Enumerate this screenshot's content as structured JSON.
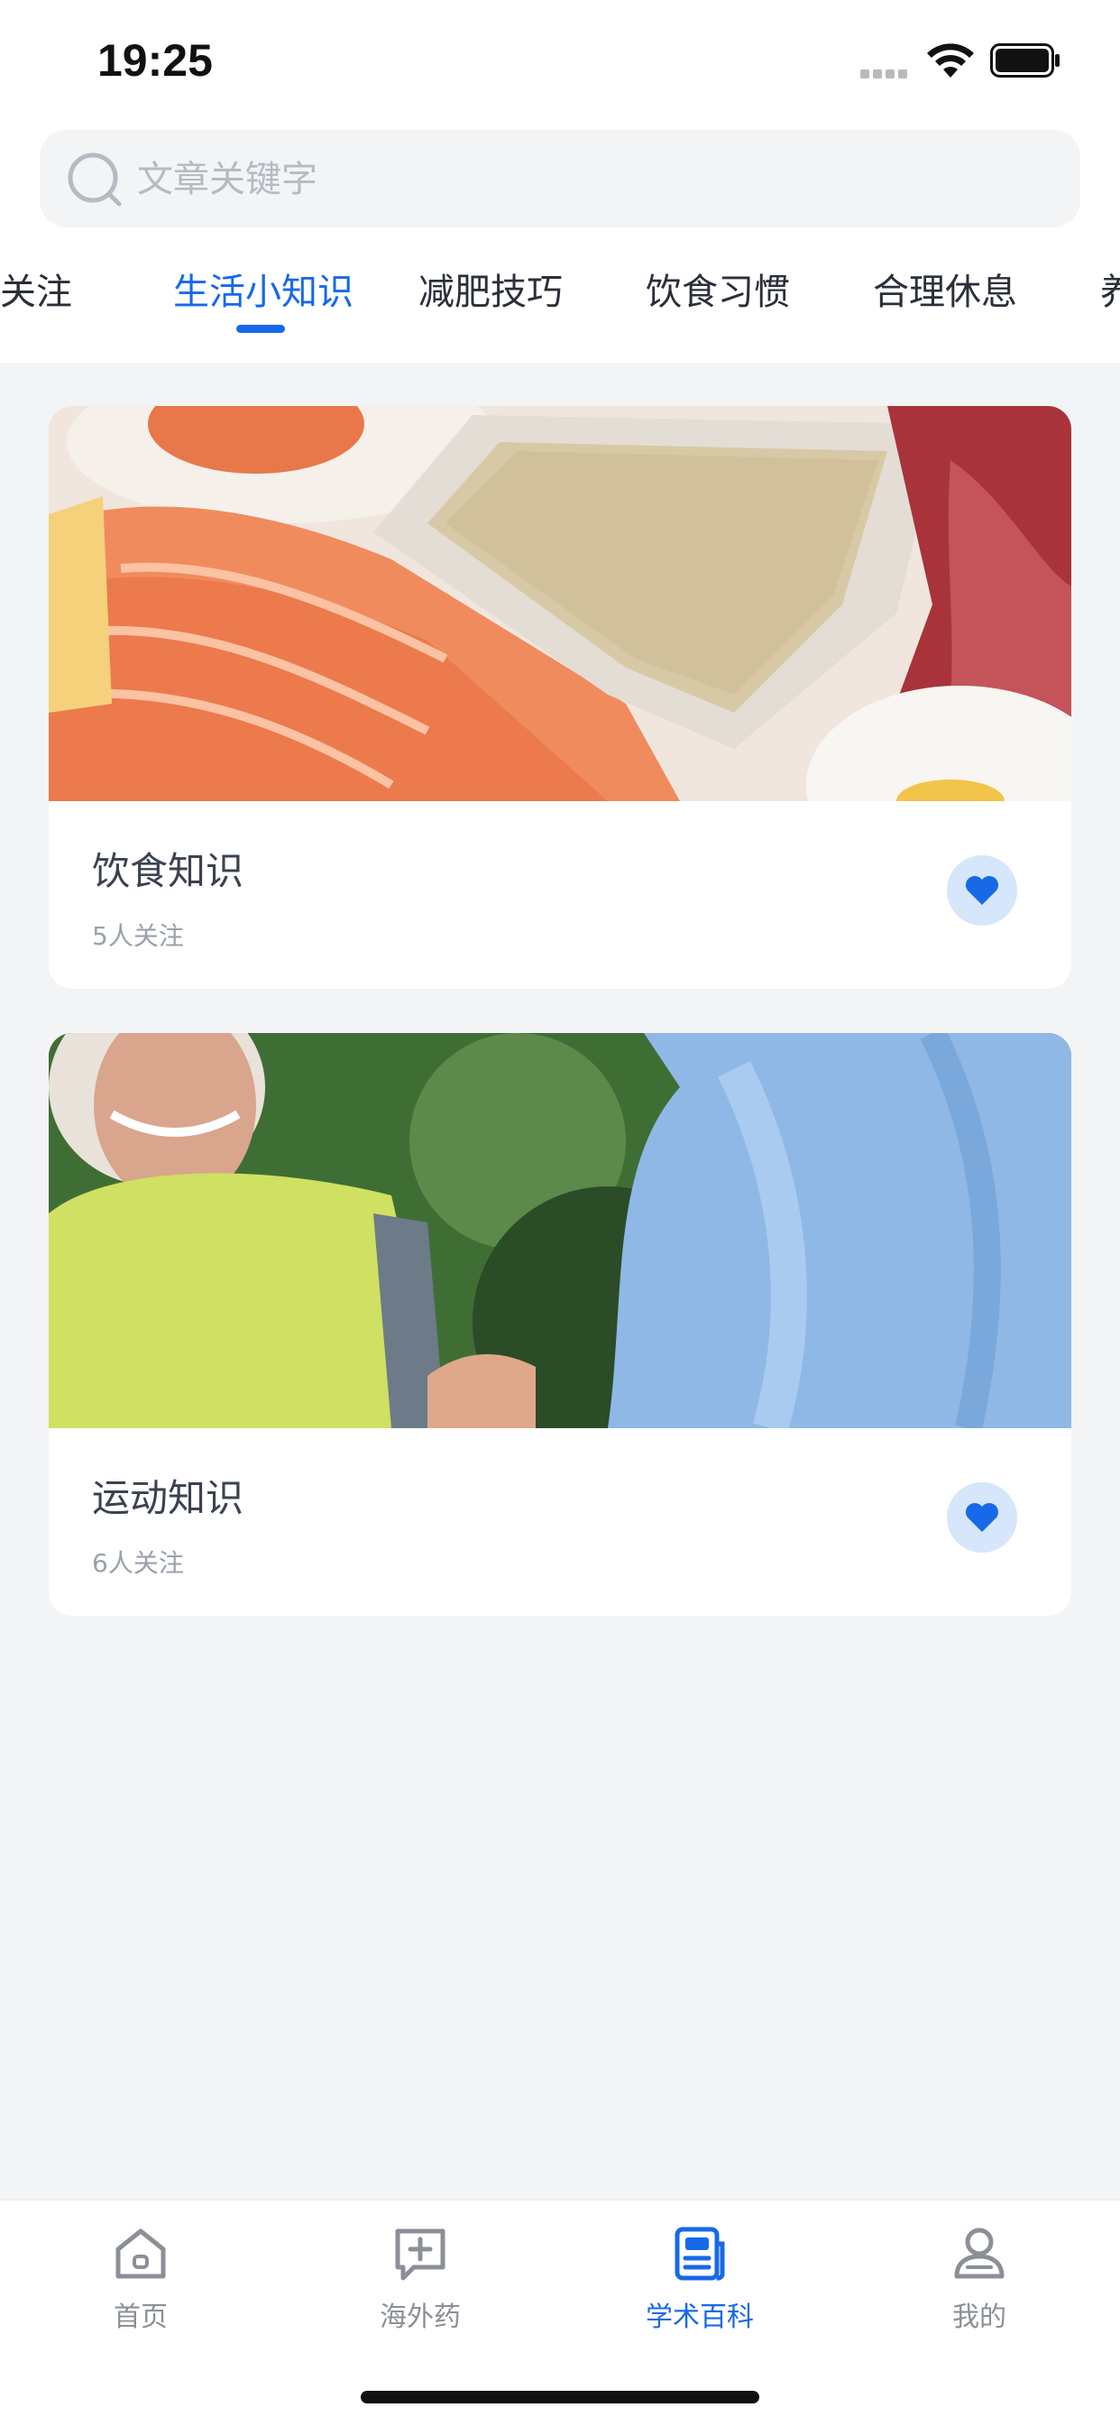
{
  "status_bar": {
    "time": "19:25"
  },
  "search": {
    "placeholder": "文章关键字"
  },
  "tabs": [
    {
      "label": "关注"
    },
    {
      "label": "生活小知识",
      "active": true
    },
    {
      "label": "减肥技巧"
    },
    {
      "label": "饮食习惯"
    },
    {
      "label": "合理休息"
    },
    {
      "label": "养"
    }
  ],
  "cards": [
    {
      "title": "饮食知识",
      "followers": "5人关注",
      "image": "food-photo"
    },
    {
      "title": "运动知识",
      "followers": "6人关注",
      "image": "exercise-photo"
    }
  ],
  "tabbar": {
    "items": [
      {
        "label": "首页",
        "icon": "home-icon"
      },
      {
        "label": "海外药",
        "icon": "medicine-plus-icon"
      },
      {
        "label": "学术百科",
        "icon": "article-icon",
        "active": true
      },
      {
        "label": "我的",
        "icon": "profile-icon"
      }
    ]
  },
  "colors": {
    "accent": "#1769e8",
    "background": "#f3f4f6",
    "fav_bg": "#d6e6fb"
  }
}
